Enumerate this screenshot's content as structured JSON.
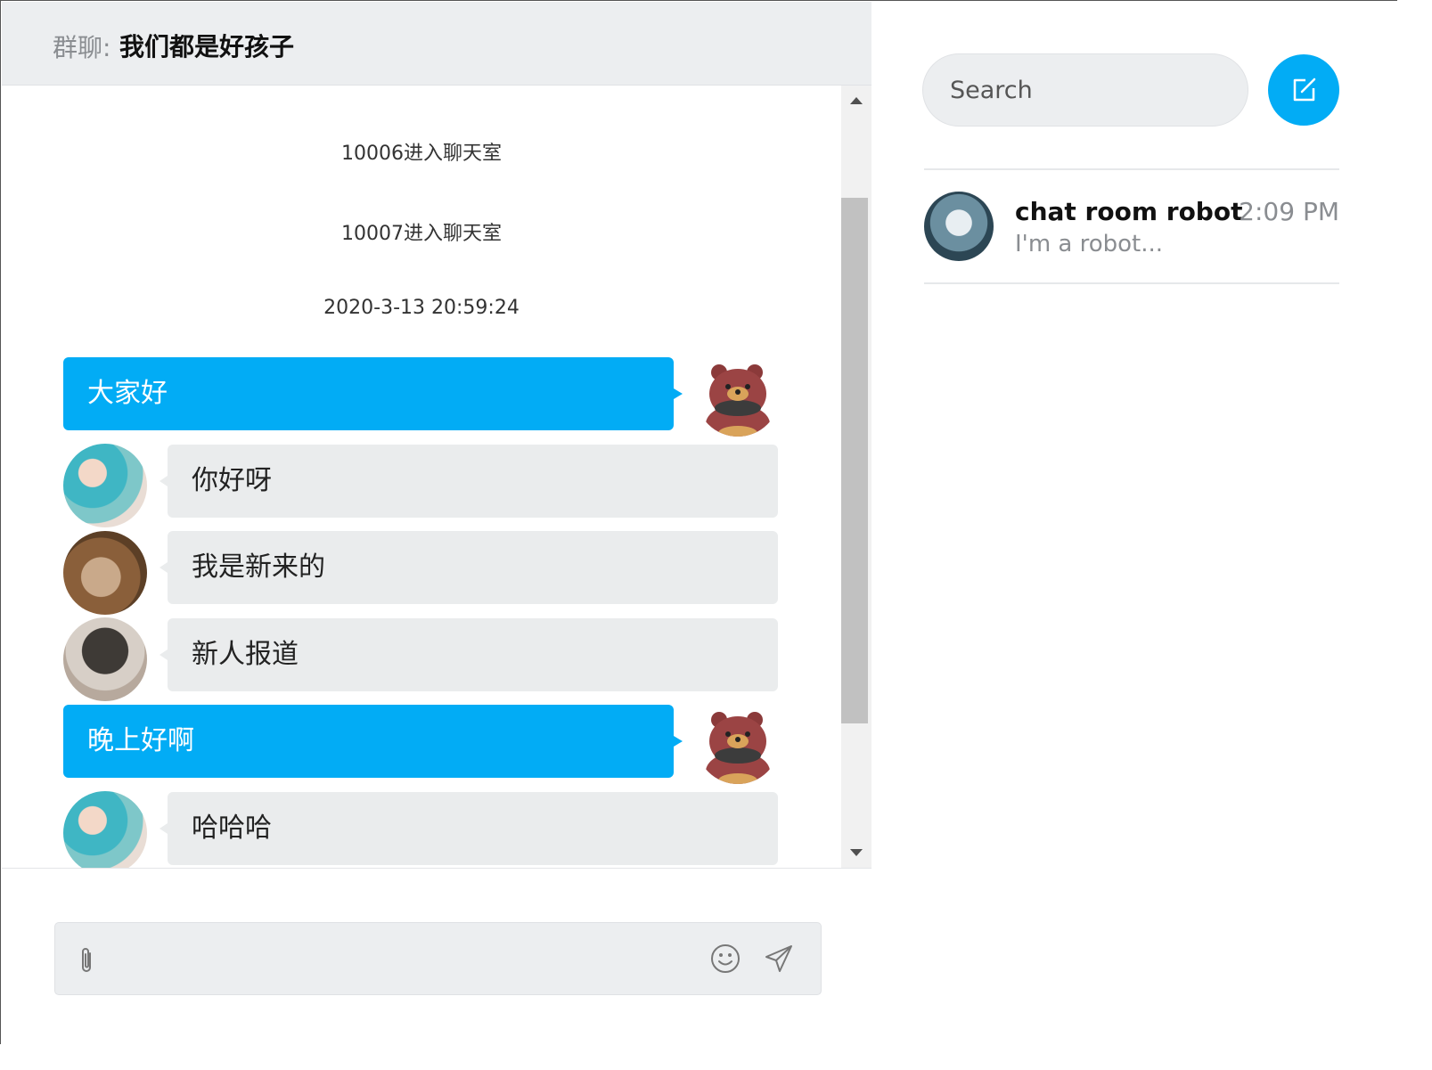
{
  "chat": {
    "header_prefix": "群聊:",
    "title": "我们都是好孩子",
    "system_messages": [
      "10006进入聊天室",
      "10007进入聊天室",
      "2020-3-13 20:59:24"
    ],
    "messages": [
      {
        "direction": "out",
        "text": "大家好",
        "avatar": "bear-avatar"
      },
      {
        "direction": "in",
        "text": "你好呀",
        "avatar": "girl-avatar"
      },
      {
        "direction": "in",
        "text": "我是新来的",
        "avatar": "fish-avatar"
      },
      {
        "direction": "in",
        "text": "新人报道",
        "avatar": "head-avatar"
      },
      {
        "direction": "out",
        "text": "晚上好啊",
        "avatar": "bear-avatar"
      },
      {
        "direction": "in",
        "text": "哈哈哈",
        "avatar": "girl-avatar"
      }
    ]
  },
  "composer": {
    "placeholder": "",
    "attach_icon": "paperclip-icon",
    "emoji_icon": "smiley-icon",
    "send_icon": "send-icon"
  },
  "sidebar": {
    "search_placeholder": "Search",
    "compose_icon": "compose-icon",
    "conversations": [
      {
        "name": "chat room robot",
        "time": "2:09 PM",
        "preview": "I'm a robot..."
      }
    ]
  },
  "colors": {
    "accent": "#02acf5",
    "bubble_in": "#eaeced",
    "header_bg": "#eceef0"
  }
}
